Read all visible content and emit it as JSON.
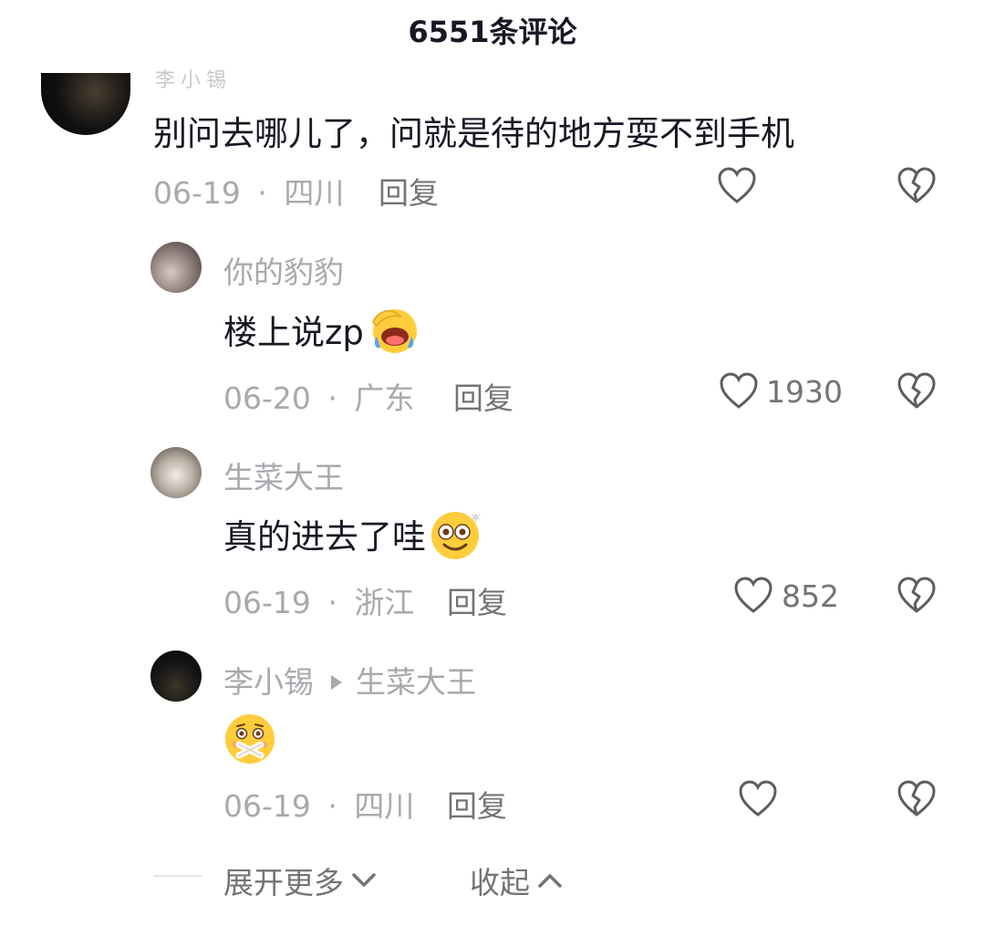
{
  "header": {
    "title": "6551条评论"
  },
  "main_comment": {
    "username_partial": "李小锡",
    "text": "别问去哪儿了，问就是待的地方耍不到手机",
    "date": "06-19",
    "location": "四川",
    "reply_label": "回复"
  },
  "replies": [
    {
      "username": "你的豹豹",
      "text": "楼上说zp",
      "date": "06-20",
      "location": "广东",
      "reply_label": "回复",
      "likes": "1930"
    },
    {
      "username": "生菜大王",
      "text": "真的进去了哇",
      "date": "06-19",
      "location": "浙江",
      "reply_label": "回复",
      "likes": "852"
    },
    {
      "username": "李小锡",
      "reply_to": "生菜大王",
      "text": "",
      "date": "06-19",
      "location": "四川",
      "reply_label": "回复",
      "likes": ""
    }
  ],
  "footer": {
    "expand_more": "展开更多",
    "collapse": "收起"
  },
  "separator": "·",
  "icons": {
    "like": "heart-outline-icon",
    "dislike": "broken-heart-icon",
    "emoji_facepalm": "grinning-sweat-emoji",
    "emoji_surprise": "dizzy-smile-emoji",
    "emoji_shy": "mouth-covered-blush-emoji",
    "expand": "chevron-down-icon",
    "collapse": "chevron-up-icon"
  },
  "colors": {
    "text": "#161823",
    "meta": "#a8a9ae",
    "action": "#737478"
  }
}
